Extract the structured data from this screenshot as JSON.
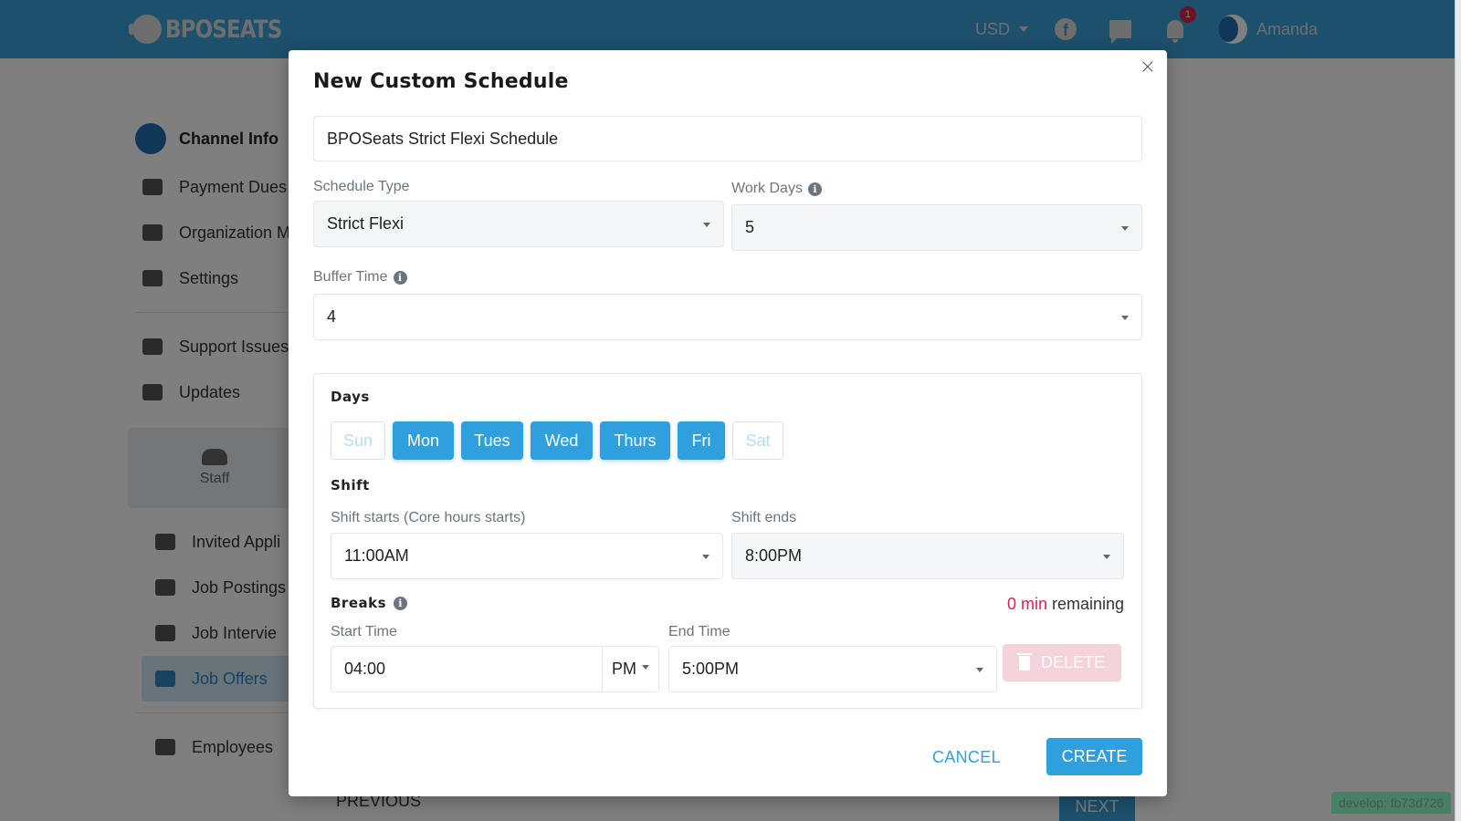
{
  "header": {
    "brand": "BPOSEATS",
    "currency": "USD",
    "notification_count": "1",
    "username": "Amanda",
    "icons": [
      "facebook-icon",
      "chat-icon",
      "bell-icon"
    ]
  },
  "sidebar": {
    "channel_title": "Channel Info",
    "items": [
      {
        "label": "Payment Dues",
        "icon": "book-icon"
      },
      {
        "label": "Organization M",
        "icon": "people-icon"
      },
      {
        "label": "Settings",
        "icon": "gear-icon"
      },
      {
        "label": "Support Issues",
        "icon": "ticket-icon"
      },
      {
        "label": "Updates",
        "icon": "megaphone-icon"
      }
    ],
    "staff_label": "Staff",
    "staff_items": [
      {
        "label": "Invited Appli",
        "icon": "user-search-icon"
      },
      {
        "label": "Job Postings",
        "icon": "briefcase-search-icon"
      },
      {
        "label": "Job Intervie",
        "icon": "video-icon"
      },
      {
        "label": "Job Offers",
        "icon": "briefcase-icon",
        "active": true
      }
    ],
    "employees_label": "Employees"
  },
  "page": {
    "previous_label": "PREVIOUS",
    "next_label": "NEXT",
    "build_badge": "develop: fb73d726"
  },
  "modal": {
    "title": "New Custom Schedule",
    "close_label": "×",
    "schedule_name": "BPOSeats Strict Flexi Schedule",
    "schedule_type": {
      "label": "Schedule Type",
      "value": "Strict Flexi"
    },
    "work_days": {
      "label": "Work Days",
      "value": "5"
    },
    "buffer_time": {
      "label": "Buffer Time",
      "value": "4"
    },
    "days_title": "Days",
    "days": [
      {
        "label": "Sun",
        "selected": false
      },
      {
        "label": "Mon",
        "selected": true
      },
      {
        "label": "Tues",
        "selected": true
      },
      {
        "label": "Wed",
        "selected": true
      },
      {
        "label": "Thurs",
        "selected": true
      },
      {
        "label": "Fri",
        "selected": true
      },
      {
        "label": "Sat",
        "selected": false
      }
    ],
    "shift_title": "Shift",
    "shift_starts": {
      "label": "Shift starts (Core hours starts)",
      "value": "11:00AM"
    },
    "shift_ends": {
      "label": "Shift ends",
      "value": "8:00PM"
    },
    "breaks_title": "Breaks",
    "remaining_value": "0 min",
    "remaining_suffix": " remaining",
    "break_start": {
      "label": "Start Time",
      "value": "04:00",
      "meridiem": "PM"
    },
    "break_end": {
      "label": "End Time",
      "value": "5:00PM"
    },
    "delete_label": "DELETE",
    "cancel_label": "CANCEL",
    "create_label": "CREATE"
  },
  "colors": {
    "primary": "#2fa0dd",
    "danger": "#e0204a",
    "header": "#3aa0d8"
  }
}
